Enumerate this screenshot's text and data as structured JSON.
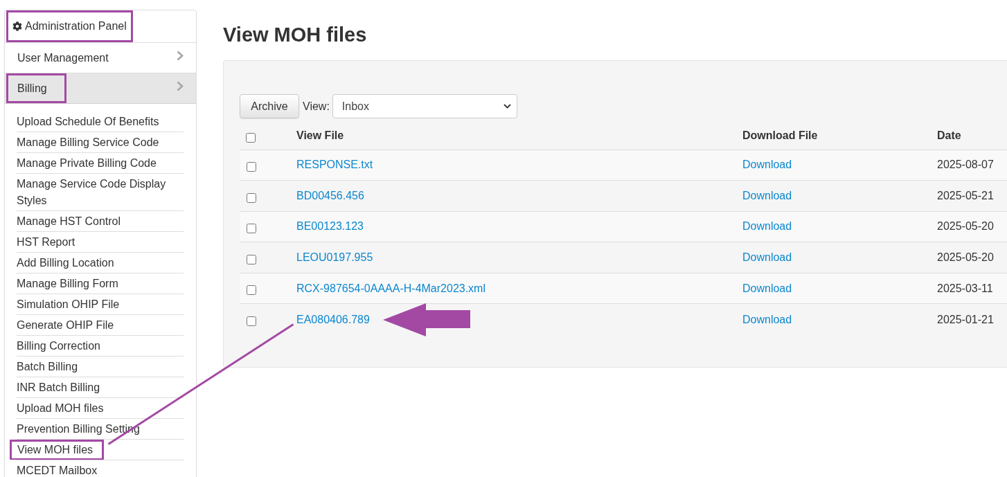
{
  "sidebar": {
    "header": {
      "title": "Administration Panel",
      "outlined": true
    },
    "sections": [
      {
        "label": "User Management",
        "expanded": false,
        "outlined": false
      },
      {
        "label": "Billing",
        "expanded": true,
        "outlined": true,
        "children": [
          {
            "label": "Upload Schedule Of Benefits",
            "outlined": false
          },
          {
            "label": "Manage Billing Service Code",
            "outlined": false
          },
          {
            "label": "Manage Private Billing Code",
            "outlined": false
          },
          {
            "label": "Manage Service Code Display Styles",
            "outlined": false
          },
          {
            "label": "Manage HST Control",
            "outlined": false
          },
          {
            "label": "HST Report",
            "outlined": false
          },
          {
            "label": "Add Billing Location",
            "outlined": false
          },
          {
            "label": "Manage Billing Form",
            "outlined": false
          },
          {
            "label": "Simulation OHIP File",
            "outlined": false
          },
          {
            "label": "Generate OHIP File",
            "outlined": false
          },
          {
            "label": "Billing Correction",
            "outlined": false
          },
          {
            "label": "Batch Billing",
            "outlined": false
          },
          {
            "label": "INR Batch Billing",
            "outlined": false
          },
          {
            "label": "Upload MOH files",
            "outlined": false
          },
          {
            "label": "Prevention Billing Setting",
            "outlined": false
          },
          {
            "label": "View MOH files",
            "outlined": true
          },
          {
            "label": "MCEDT Mailbox",
            "outlined": false
          }
        ]
      }
    ]
  },
  "page_title": "View MOH files",
  "toolbar": {
    "archive_button": "Archive",
    "view_label": "View:",
    "view_value": "Inbox"
  },
  "table": {
    "select_all_checked": false,
    "columns": [
      "View File",
      "Download File",
      "Date"
    ],
    "rows": [
      {
        "checked": false,
        "file": "RESPONSE.txt",
        "download": "Download",
        "date": "2025-08-07",
        "pointer_arrow": false
      },
      {
        "checked": false,
        "file": "BD00456.456",
        "download": "Download",
        "date": "2025-05-21",
        "pointer_arrow": false
      },
      {
        "checked": false,
        "file": "BE00123.123",
        "download": "Download",
        "date": "2025-05-20",
        "pointer_arrow": false
      },
      {
        "checked": false,
        "file": "LEOU0197.955",
        "download": "Download",
        "date": "2025-05-20",
        "pointer_arrow": false
      },
      {
        "checked": false,
        "file": "RCX-987654-0AAAA-H-4Mar2023.xml",
        "download": "Download",
        "date": "2025-03-11",
        "pointer_arrow": false
      },
      {
        "checked": false,
        "file": "EA080406.789",
        "download": "Download",
        "date": "2025-01-21",
        "pointer_arrow": true
      }
    ]
  },
  "connector_line": true
}
